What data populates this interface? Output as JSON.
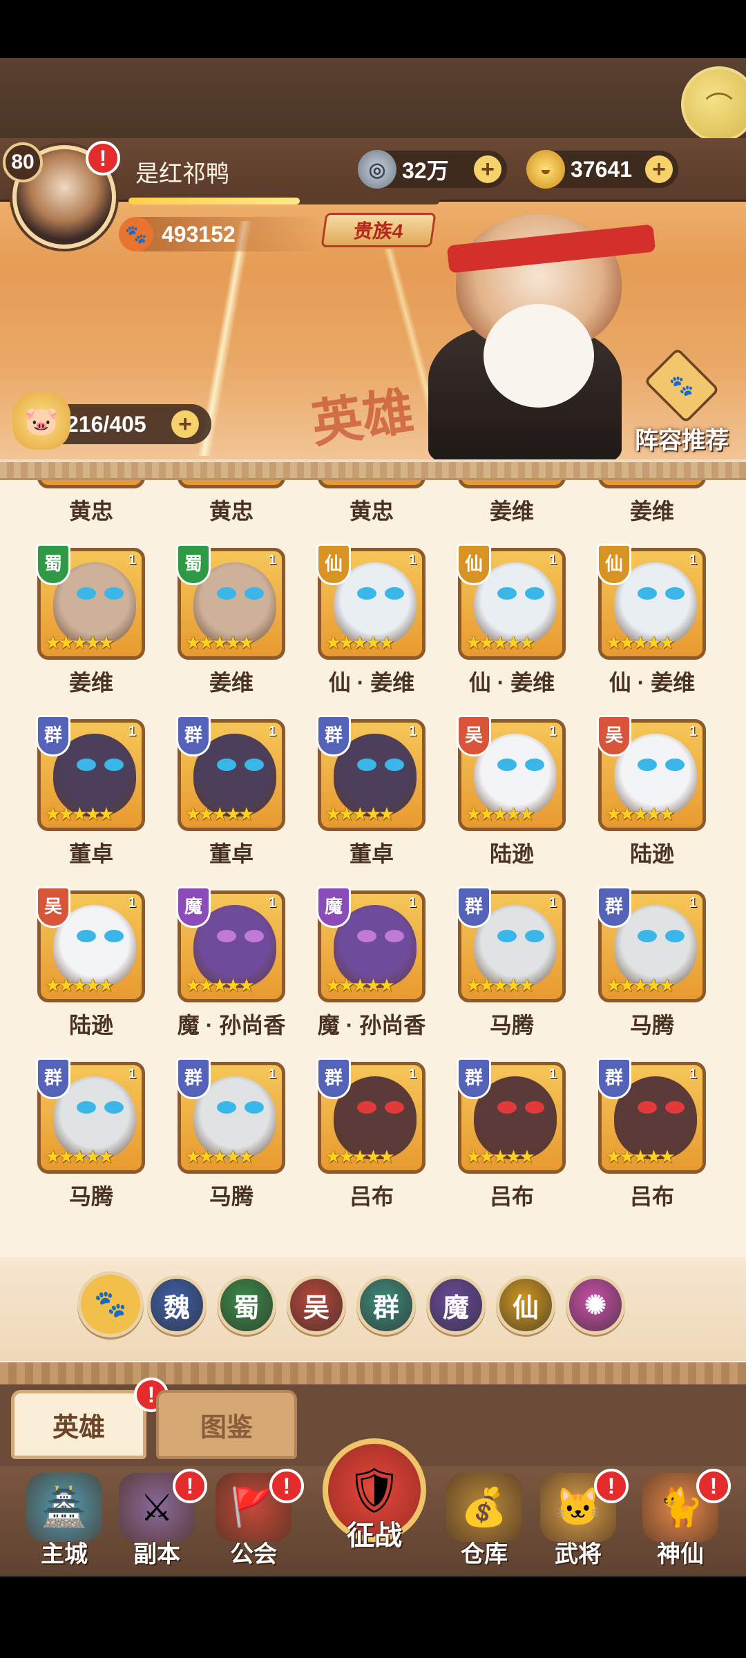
{
  "profile": {
    "level": "80",
    "username": "是红祁鸭",
    "power": "493152",
    "noble": "贵族4"
  },
  "currencies": {
    "coins": "32万",
    "ingots": "37641"
  },
  "stamina": "216/405",
  "banner": {
    "watermark": "英雄",
    "lineup_label": "阵容推荐"
  },
  "alert_mark": "!",
  "plus_mark": "+",
  "heroes": [
    {
      "name": "黄忠",
      "level": "",
      "faction": "",
      "color": "#2e8b3d",
      "fur": "#d7a36a"
    },
    {
      "name": "黄忠",
      "level": "",
      "faction": "",
      "color": "#2e8b3d",
      "fur": "#d7a36a"
    },
    {
      "name": "黄忠",
      "level": "",
      "faction": "",
      "color": "#2e8b3d",
      "fur": "#d7a36a"
    },
    {
      "name": "姜维",
      "level": "",
      "faction": "",
      "color": "#2e8b3d",
      "fur": "#7b4a6e"
    },
    {
      "name": "姜维",
      "level": "",
      "faction": "",
      "color": "#2e8b3d",
      "fur": "#7b4a6e"
    },
    {
      "name": "姜维",
      "level": "1",
      "faction": "蜀",
      "color": "#2f9a45",
      "fur": "#cdb299"
    },
    {
      "name": "姜维",
      "level": "1",
      "faction": "蜀",
      "color": "#2f9a45",
      "fur": "#cdb299"
    },
    {
      "name": "仙 · 姜维",
      "level": "1",
      "faction": "仙",
      "color": "#d89325",
      "fur": "#e8eef2"
    },
    {
      "name": "仙 · 姜维",
      "level": "1",
      "faction": "仙",
      "color": "#d89325",
      "fur": "#e8eef2"
    },
    {
      "name": "仙 · 姜维",
      "level": "1",
      "faction": "仙",
      "color": "#d89325",
      "fur": "#e8eef2"
    },
    {
      "name": "董卓",
      "level": "1",
      "faction": "群",
      "color": "#5462b8",
      "fur": "#4c3f5c"
    },
    {
      "name": "董卓",
      "level": "1",
      "faction": "群",
      "color": "#5462b8",
      "fur": "#4c3f5c"
    },
    {
      "name": "董卓",
      "level": "1",
      "faction": "群",
      "color": "#5462b8",
      "fur": "#4c3f5c"
    },
    {
      "name": "陆逊",
      "level": "1",
      "faction": "吴",
      "color": "#d8553a",
      "fur": "#f3f4f6"
    },
    {
      "name": "陆逊",
      "level": "1",
      "faction": "吴",
      "color": "#d8553a",
      "fur": "#f3f4f6"
    },
    {
      "name": "陆逊",
      "level": "1",
      "faction": "吴",
      "color": "#d8553a",
      "fur": "#f3f4f6"
    },
    {
      "name": "魔 · 孙尚香",
      "level": "1",
      "faction": "魔",
      "color": "#8b4bb8",
      "fur": "#6f4b9b"
    },
    {
      "name": "魔 · 孙尚香",
      "level": "1",
      "faction": "魔",
      "color": "#8b4bb8",
      "fur": "#6f4b9b"
    },
    {
      "name": "马腾",
      "level": "1",
      "faction": "群",
      "color": "#5462b8",
      "fur": "#dfe3e4"
    },
    {
      "name": "马腾",
      "level": "1",
      "faction": "群",
      "color": "#5462b8",
      "fur": "#dfe3e4"
    },
    {
      "name": "马腾",
      "level": "1",
      "faction": "群",
      "color": "#5462b8",
      "fur": "#dfe3e4"
    },
    {
      "name": "马腾",
      "level": "1",
      "faction": "群",
      "color": "#5462b8",
      "fur": "#dfe3e4"
    },
    {
      "name": "吕布",
      "level": "1",
      "faction": "群",
      "color": "#5462b8",
      "fur": "#5b3a3a"
    },
    {
      "name": "吕布",
      "level": "1",
      "faction": "群",
      "color": "#5462b8",
      "fur": "#5b3a3a"
    },
    {
      "name": "吕布",
      "level": "1",
      "faction": "群",
      "color": "#5462b8",
      "fur": "#5b3a3a"
    }
  ],
  "hero_stars": "★★★★★",
  "filters": [
    {
      "label": "🐾",
      "color": "#f0b23a",
      "icon": "paw-icon"
    },
    {
      "label": "魏",
      "color": "#3d5fa8",
      "icon": "wei-faction-icon"
    },
    {
      "label": "蜀",
      "color": "#3c8a48",
      "icon": "shu-faction-icon"
    },
    {
      "label": "吴",
      "color": "#b9473a",
      "icon": "wu-faction-icon"
    },
    {
      "label": "群",
      "color": "#3e8a7a",
      "icon": "qun-faction-icon"
    },
    {
      "label": "魔",
      "color": "#6a4a9c",
      "icon": "mo-faction-icon"
    },
    {
      "label": "仙",
      "color": "#d0961f",
      "icon": "xian-faction-icon"
    },
    {
      "label": "✺",
      "color": "#c94fa8",
      "icon": "special-faction-icon"
    }
  ],
  "tabs": {
    "active": "英雄",
    "inactive": "图鉴"
  },
  "nav": [
    {
      "label": "主城",
      "icon": "🏯",
      "color": "#4e9fb8",
      "alert": false
    },
    {
      "label": "副本",
      "icon": "⚔",
      "color": "#8a6a9c",
      "alert": true
    },
    {
      "label": "公会",
      "icon": "🚩",
      "color": "#c4493a",
      "alert": true
    },
    {
      "label": "征战",
      "icon": "🛡",
      "center": true,
      "alert": false
    },
    {
      "label": "仓库",
      "icon": "💰",
      "color": "#b88a3a",
      "alert": false
    },
    {
      "label": "武将",
      "icon": "🐱",
      "color": "#d8a04a",
      "alert": true
    },
    {
      "label": "神仙",
      "icon": "🐈",
      "color": "#e88a4a",
      "alert": true
    }
  ]
}
